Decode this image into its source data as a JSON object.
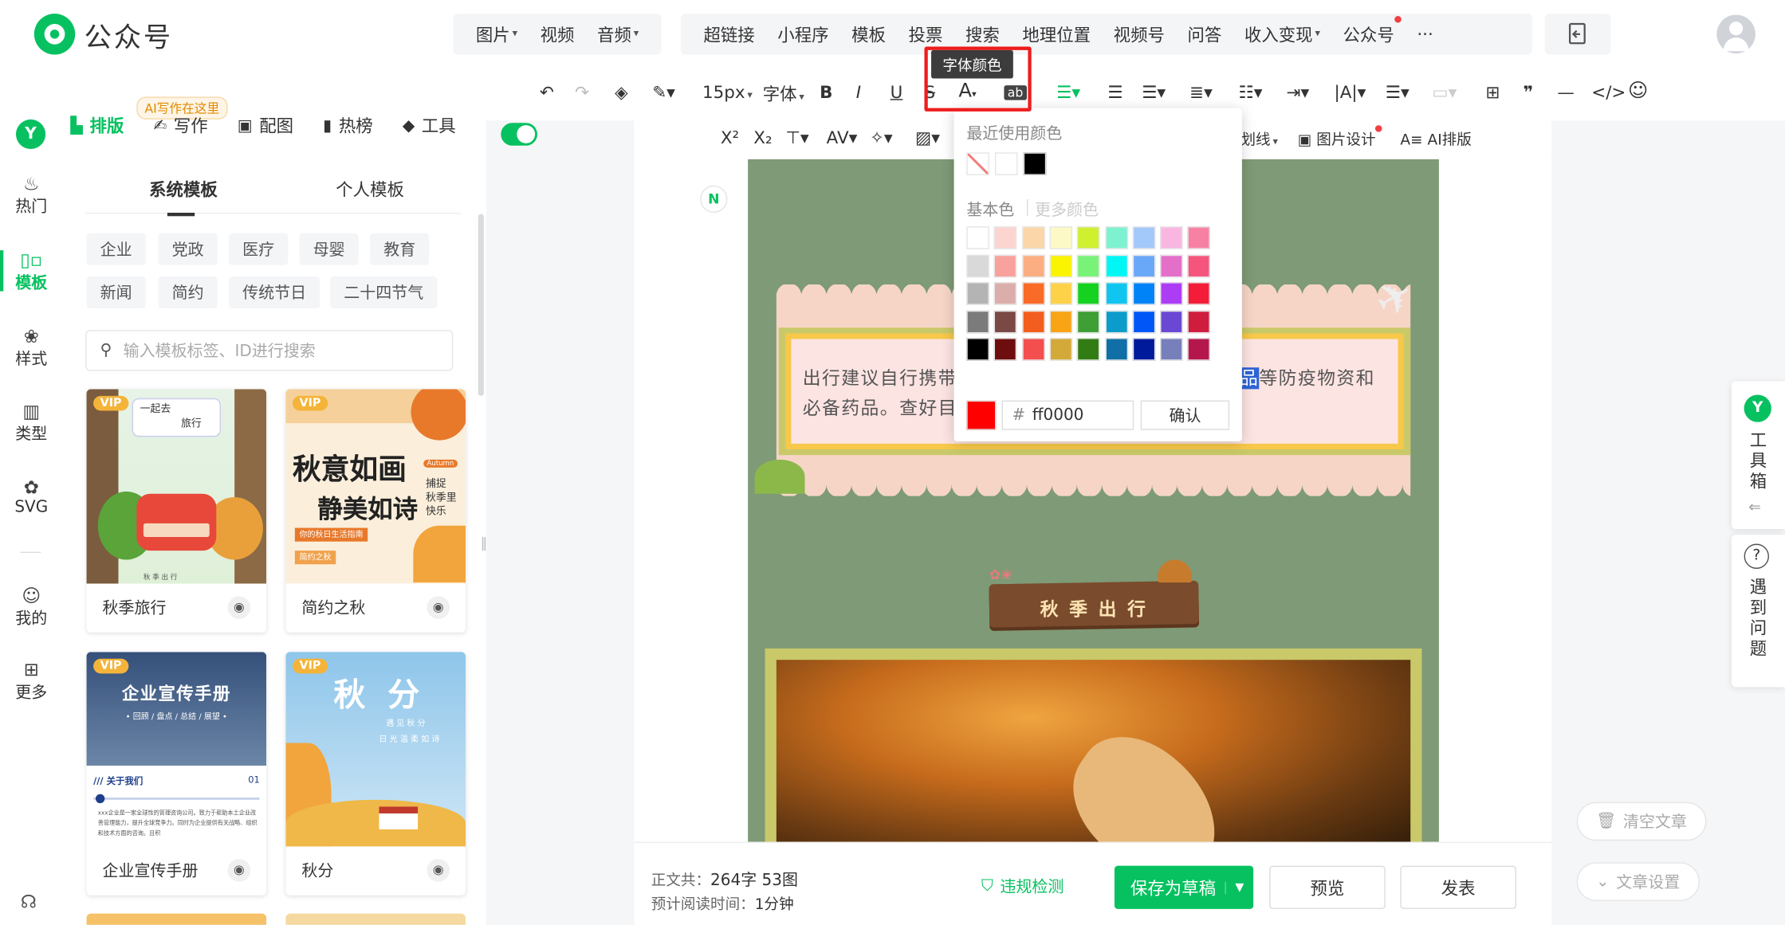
{
  "app": {
    "title": "公众号"
  },
  "topbar": {
    "group1": [
      {
        "label": "图片",
        "caret": true
      },
      {
        "label": "视频",
        "caret": false
      },
      {
        "label": "音频",
        "caret": true
      }
    ],
    "group2": [
      {
        "label": "超链接",
        "caret": false
      },
      {
        "label": "小程序",
        "caret": false
      },
      {
        "label": "模板",
        "caret": false
      },
      {
        "label": "投票",
        "caret": false
      },
      {
        "label": "搜索",
        "caret": false
      },
      {
        "label": "地理位置",
        "caret": false
      },
      {
        "label": "视频号",
        "caret": false
      },
      {
        "label": "问答",
        "caret": false
      },
      {
        "label": "收入变现",
        "caret": true
      },
      {
        "label": "公众号",
        "caret": false
      },
      {
        "label": "···",
        "caret": false
      }
    ]
  },
  "format_toolbar": {
    "font_size": "15px",
    "font_family": "字体",
    "tooltip": "字体颜色",
    "row2_items": [
      "X²",
      "X₂"
    ],
    "row2_right": [
      "划线",
      "图片设计",
      "AI排版"
    ]
  },
  "leftnav": {
    "items": [
      {
        "label": "热门",
        "icon": "fire-icon"
      },
      {
        "label": "模板",
        "icon": "template-icon"
      },
      {
        "label": "样式",
        "icon": "style-icon"
      },
      {
        "label": "类型",
        "icon": "type-icon"
      },
      {
        "label": "SVG",
        "icon": "svg-icon"
      },
      {
        "label": "我的",
        "icon": "user-icon"
      },
      {
        "label": "更多",
        "icon": "more-icon"
      }
    ]
  },
  "panel": {
    "ai_bubble": "AI写作在这里",
    "tabs": [
      "排版",
      "写作",
      "配图",
      "热榜",
      "工具"
    ],
    "subtabs": [
      "系统模板",
      "个人模板"
    ],
    "chips": [
      "企业",
      "党政",
      "医疗",
      "母婴",
      "教育",
      "新闻",
      "简约",
      "传统节日",
      "二十四节气"
    ],
    "search_placeholder": "输入模板标签、ID进行搜索",
    "cards": [
      {
        "name": "秋季旅行",
        "vip": "VIP"
      },
      {
        "name": "简约之秋",
        "vip": "VIP"
      },
      {
        "name": "企业宣传手册",
        "vip": "VIP"
      },
      {
        "name": "秋分",
        "vip": "VIP"
      }
    ],
    "card_texts": {
      "c1_a": "一起去",
      "c1_b": "旅行",
      "c1_c": "秋 季 出 行",
      "c2_a": "秋意如画",
      "c2_b": "静美如诗",
      "c2_c": "Autumn",
      "c2_d": "捕捉",
      "c2_e": "秋季里",
      "c2_f": "快乐",
      "c2_g": "你的秋日生活指南",
      "c2_h": "简约之秋",
      "c3_a": "企业宣传手册",
      "c3_b": "• 回顾 / 盘点 / 总结 / 展望 •",
      "c3_c": "/// 关于我们",
      "c3_d": "01",
      "c3_e": "xxx企业是一家全球性的管理咨询公司。致力于帮助本土企业改善管理能力，提升全球竞争力。同时为企业提供有关战略、组织和技术方面的咨询。且积",
      "c4_a": "秋  分",
      "c4_b": "遇 见 秋 分",
      "c4_c": "日 光 温 柔 如 诗"
    }
  },
  "picker": {
    "recent_label": "最近使用颜色",
    "basic_label": "基本色",
    "more_label": "更多颜色",
    "hex_prefix": "#",
    "hex_value": "ff0000",
    "confirm": "确认",
    "recent": [
      "none",
      "#ffffff",
      "#000000"
    ],
    "palette": [
      [
        "#ffffff",
        "#fcd4d0",
        "#fbd6a8",
        "#fdf9c6",
        "#cef02f",
        "#7cf2d0",
        "#a3c8fa",
        "#f9b6e0",
        "#f781a3"
      ],
      [
        "#d9d9d9",
        "#f8a19d",
        "#fbae82",
        "#fbf400",
        "#79f278",
        "#00f7f6",
        "#69a7f9",
        "#e36fc9",
        "#f5557c"
      ],
      [
        "#b4b4b4",
        "#dbaeab",
        "#f96b26",
        "#fdd249",
        "#14d21f",
        "#10c6f1",
        "#0083f7",
        "#ad3df5",
        "#f31d3a"
      ],
      [
        "#7b7b7b",
        "#7a4945",
        "#f35d1d",
        "#f8a414",
        "#3e9f34",
        "#0c9ccb",
        "#0056f6",
        "#6b48d4",
        "#d01d3e"
      ],
      [
        "#000000",
        "#6e0d0d",
        "#f44e4e",
        "#d3aa3a",
        "#327c14",
        "#0f6fa6",
        "#001a9c",
        "#7780bb",
        "#b5174c"
      ]
    ]
  },
  "article": {
    "para_left_1": "出行建议自行携带",
    "para_left_2": "必备药品。查好目",
    "para_right_hl": "品",
    "para_right": "等防疫物资和",
    "title_sign": "秋 季 出 行"
  },
  "footer": {
    "label1": "正文共：",
    "value1": "264字 53图",
    "label2": "预计阅读时间：",
    "value2": "1分钟",
    "check": "违规检测",
    "save": "保存为草稿",
    "preview": "预览",
    "publish": "发表"
  },
  "right": {
    "toolbox": "工具箱",
    "help": "遇到问题",
    "clear": "清空文章",
    "settings": "文章设置"
  },
  "colors": {
    "brand": "#07c160",
    "highlight": "#ee1c1c",
    "article_bg": "#7e9a76"
  }
}
